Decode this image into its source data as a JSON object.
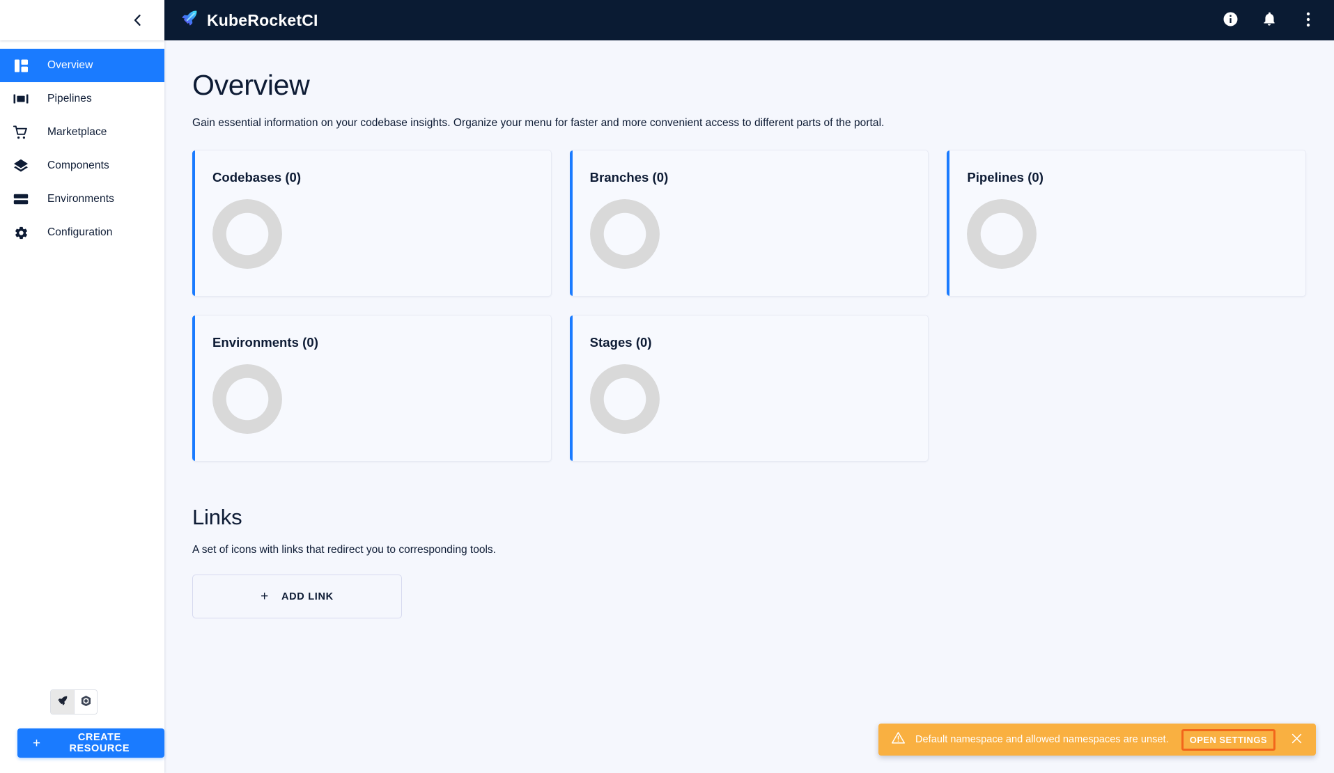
{
  "sidebar": {
    "collapse_icon": "chevron-left-icon",
    "items": [
      {
        "label": "Overview",
        "icon": "dashboard-icon",
        "active": true
      },
      {
        "label": "Pipelines",
        "icon": "pipelines-icon",
        "active": false
      },
      {
        "label": "Marketplace",
        "icon": "cart-icon",
        "active": false
      },
      {
        "label": "Components",
        "icon": "layers-icon",
        "active": false
      },
      {
        "label": "Environments",
        "icon": "stack-icon",
        "active": false
      },
      {
        "label": "Configuration",
        "icon": "gear-icon",
        "active": false
      }
    ],
    "view_toggle": [
      {
        "icon": "rocket-icon",
        "selected": true
      },
      {
        "icon": "kubernetes-icon",
        "selected": false
      }
    ],
    "create_resource_label": "CREATE RESOURCE",
    "create_resource_plus": "+"
  },
  "topbar": {
    "brand": "KubeRocketCI",
    "logo_icon": "kuberocket-rocket-icon",
    "actions": [
      {
        "icon": "info-icon"
      },
      {
        "icon": "bell-icon"
      },
      {
        "icon": "more-vertical-icon"
      }
    ]
  },
  "main": {
    "title": "Overview",
    "subtitle": "Gain essential information on your codebase insights. Organize your menu for faster and more convenient access to different parts of the portal.",
    "cards": [
      {
        "title": "Codebases (0)",
        "count": 0
      },
      {
        "title": "Branches (0)",
        "count": 0
      },
      {
        "title": "Pipelines (0)",
        "count": 0
      },
      {
        "title": "Environments (0)",
        "count": 0
      },
      {
        "title": "Stages (0)",
        "count": 0
      }
    ],
    "links": {
      "title": "Links",
      "subtitle": "A set of icons with links that redirect you to corresponding tools.",
      "add_link_label": "ADD LINK",
      "add_link_plus": "+"
    }
  },
  "snackbar": {
    "icon": "warning-triangle-icon",
    "message": "Default namespace and allowed namespaces are unset.",
    "action_label": "OPEN SETTINGS",
    "close_icon": "close-icon"
  },
  "colors": {
    "accent": "#1a7bff",
    "topbar_bg": "#0a1b33",
    "page_bg": "#f5f7fd",
    "card_bg": "#f7f9fe",
    "donut_empty": "#d9d9d9",
    "warning_bg": "#f9b041",
    "warning_focus": "#f2661b"
  }
}
